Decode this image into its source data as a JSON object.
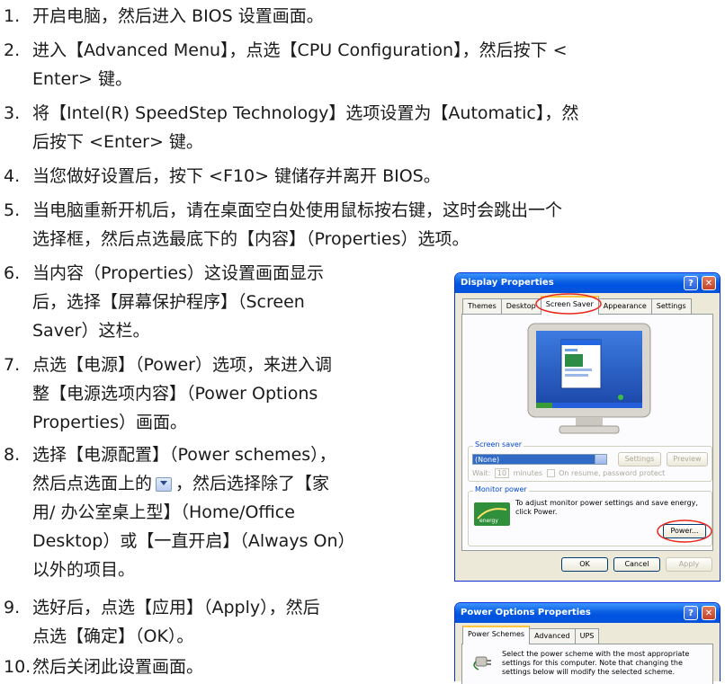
{
  "steps": [
    {
      "num": "1.",
      "lines": [
        "开启电脑，然后进入 BIOS 设置画面。"
      ]
    },
    {
      "num": "2.",
      "lines": [
        "进入【Advanced Menu】，点选【CPU Configuration】，然后按下 <",
        "Enter> 键。"
      ]
    },
    {
      "num": "3.",
      "lines": [
        "将【Intel(R) SpeedStep Technology】选项设置为【Automatic】，然",
        "后按下 <Enter> 键。"
      ]
    },
    {
      "num": "4.",
      "lines": [
        "当您做好设置后，按下 <F10> 键储存并离开 BIOS。"
      ]
    },
    {
      "num": "5.",
      "lines": [
        "当电脑重新开机后，请在桌面空白处使用鼠标按右键，这时会跳出一个",
        "选择框，然后点选最底下的【内容】（Properties）选项。"
      ]
    },
    {
      "num": "6.",
      "lines": [
        "当内容（Properties）这设置画面显示",
        "后，选择【屏幕保护程序】（Screen",
        "Saver）这栏。"
      ]
    },
    {
      "num": "7.",
      "lines": [
        "点选【电源】（Power）选项，来进入调",
        "整【电源选项内容】（Power Options",
        "Properties）画面。"
      ]
    },
    {
      "num": "8.",
      "lines_a": [
        "选择【电源配置】（Power schemes），",
        "然后点选面上的"
      ],
      "line_b_tail": "，然后选择除了【家",
      "lines_c": [
        "用/ 办公室桌上型】（Home/Office",
        "Desktop）或【一直开启】（Always On）",
        "以外的项目。"
      ]
    },
    {
      "num": "9.",
      "lines": [
        "选好后，点选【应用】（Apply），然后",
        "点选【确定】（OK）。"
      ]
    },
    {
      "num": "10.",
      "lines": [
        "然后关闭此设置画面。"
      ]
    }
  ],
  "display_props": {
    "title": "Display Properties",
    "tabs": [
      "Themes",
      "Desktop",
      "Screen Saver",
      "Appearance",
      "Settings"
    ],
    "active_tab": "Screen Saver",
    "screen_saver_label": "Screen saver",
    "screen_saver_value": "(None)",
    "settings_btn": "Settings",
    "preview_btn": "Preview",
    "wait_label": "Wait:",
    "wait_value": "10",
    "minutes_label": "minutes",
    "resume_label": "On resume, password protect",
    "monitor_power_label": "Monitor power",
    "monitor_power_text": "To adjust monitor power settings and save energy, click Power.",
    "power_btn": "Power...",
    "ok_btn": "OK",
    "cancel_btn": "Cancel",
    "apply_btn": "Apply"
  },
  "power_props": {
    "title": "Power Options Properties",
    "tabs": [
      "Power Schemes",
      "Advanced",
      "UPS"
    ],
    "active_tab": "Power Schemes",
    "description": "Select the power scheme with the most appropriate settings for this computer. Note that changing the settings below will modify the selected scheme."
  },
  "colors": {
    "xp_blue": "#0054e3",
    "highlight_red": "#e8261c",
    "selection": "#316ac5"
  }
}
